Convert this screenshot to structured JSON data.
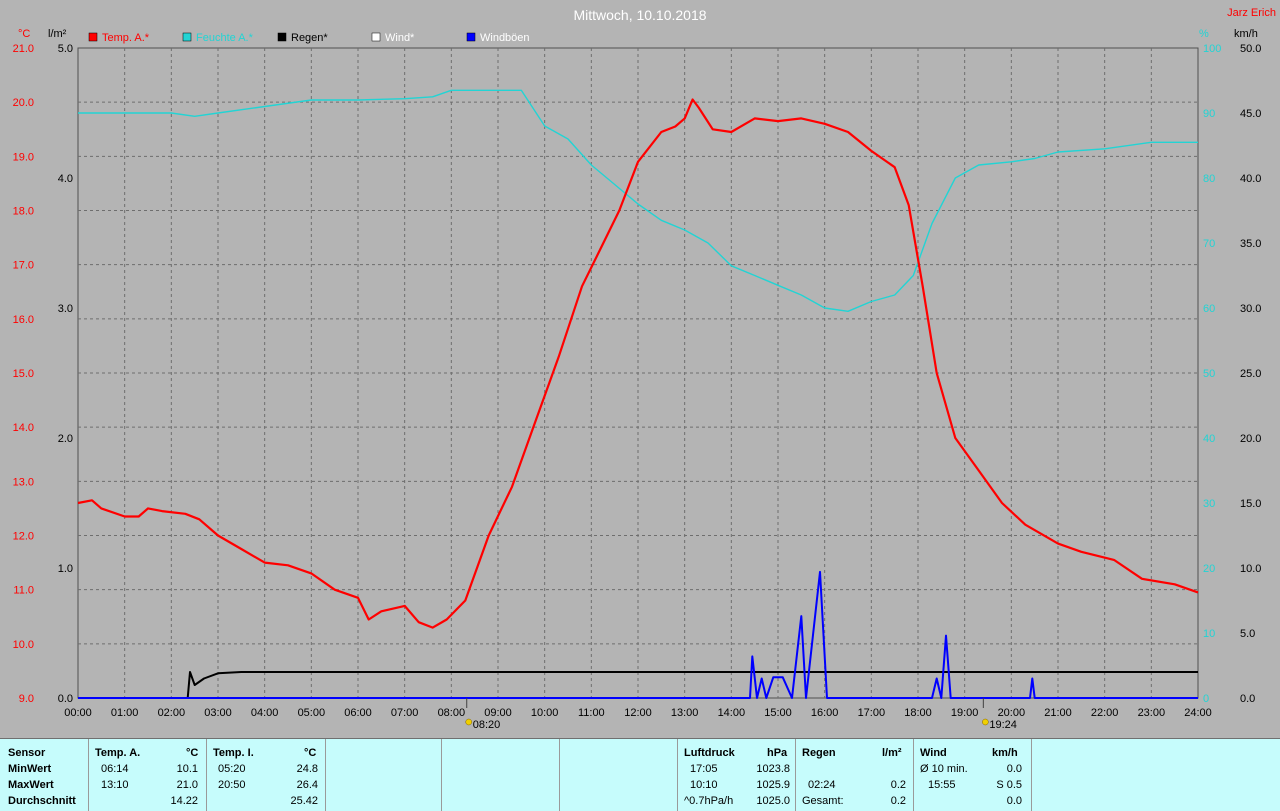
{
  "title": "Mittwoch, 10.10.2018",
  "author": "Jarz Erich",
  "colors": {
    "background": "#b4b4b4",
    "temperature": "#ff0000",
    "humidity": "#22d4d4",
    "rain": "#000000",
    "wind": "#ffffff",
    "gusts": "#0000ff",
    "panel": "#c6fcfc"
  },
  "chart_data": {
    "type": "line",
    "title": "Mittwoch, 10.10.2018",
    "x_label_format": "hh:mm",
    "xlim": [
      0,
      24
    ],
    "x_ticks": [
      "00:00",
      "01:00",
      "02:00",
      "03:00",
      "04:00",
      "05:00",
      "06:00",
      "07:00",
      "08:00",
      "09:00",
      "10:00",
      "11:00",
      "12:00",
      "13:00",
      "14:00",
      "15:00",
      "16:00",
      "17:00",
      "18:00",
      "19:00",
      "20:00",
      "21:00",
      "22:00",
      "23:00",
      "24:00"
    ],
    "axes": {
      "temperature": {
        "unit": "°C",
        "range": [
          9.0,
          21.0
        ],
        "ticks": [
          "9.0",
          "10.0",
          "11.0",
          "12.0",
          "13.0",
          "14.0",
          "15.0",
          "16.0",
          "17.0",
          "18.0",
          "19.0",
          "20.0",
          "21.0"
        ]
      },
      "rain": {
        "unit": "l/m²",
        "range": [
          0.0,
          5.0
        ],
        "ticks": [
          "0.0",
          "1.0",
          "2.0",
          "3.0",
          "4.0",
          "5.0"
        ]
      },
      "humidity": {
        "unit": "%",
        "range": [
          0,
          100
        ],
        "ticks": [
          "0",
          "10",
          "20",
          "30",
          "40",
          "50",
          "60",
          "70",
          "80",
          "90",
          "100"
        ]
      },
      "wind": {
        "unit": "km/h",
        "range": [
          0.0,
          50.0
        ],
        "ticks": [
          "0.0",
          "5.0",
          "10.0",
          "15.0",
          "20.0",
          "25.0",
          "30.0",
          "35.0",
          "40.0",
          "45.0",
          "50.0"
        ]
      }
    },
    "legend": [
      "Temp. A.*",
      "Feuchte A.*",
      "Regen*",
      "Wind*",
      "Windböen"
    ],
    "series": [
      {
        "name": "Temp. A.*",
        "axis": "temperature",
        "points": [
          [
            0,
            12.6
          ],
          [
            0.3,
            12.65
          ],
          [
            0.5,
            12.5
          ],
          [
            1,
            12.35
          ],
          [
            1.3,
            12.35
          ],
          [
            1.5,
            12.5
          ],
          [
            1.8,
            12.45
          ],
          [
            2.3,
            12.4
          ],
          [
            2.6,
            12.3
          ],
          [
            3,
            12.0
          ],
          [
            3.5,
            11.75
          ],
          [
            4,
            11.5
          ],
          [
            4.5,
            11.45
          ],
          [
            5,
            11.3
          ],
          [
            5.5,
            11.0
          ],
          [
            6.0,
            10.85
          ],
          [
            6.23,
            10.45
          ],
          [
            6.5,
            10.6
          ],
          [
            7,
            10.7
          ],
          [
            7.3,
            10.4
          ],
          [
            7.6,
            10.3
          ],
          [
            7.9,
            10.45
          ],
          [
            8.3,
            10.8
          ],
          [
            8.8,
            12.0
          ],
          [
            9.3,
            12.9
          ],
          [
            9.8,
            14.1
          ],
          [
            10.3,
            15.3
          ],
          [
            10.8,
            16.6
          ],
          [
            11.2,
            17.3
          ],
          [
            11.6,
            18.0
          ],
          [
            12.0,
            18.9
          ],
          [
            12.5,
            19.45
          ],
          [
            12.8,
            19.55
          ],
          [
            13.0,
            19.7
          ],
          [
            13.17,
            20.05
          ],
          [
            13.3,
            19.9
          ],
          [
            13.6,
            19.5
          ],
          [
            14.0,
            19.45
          ],
          [
            14.5,
            19.7
          ],
          [
            15.0,
            19.65
          ],
          [
            15.5,
            19.7
          ],
          [
            16.0,
            19.6
          ],
          [
            16.5,
            19.45
          ],
          [
            17.0,
            19.1
          ],
          [
            17.5,
            18.8
          ],
          [
            17.8,
            18.1
          ],
          [
            18.1,
            16.6
          ],
          [
            18.4,
            15.0
          ],
          [
            18.8,
            13.8
          ],
          [
            19.3,
            13.2
          ],
          [
            19.8,
            12.6
          ],
          [
            20.3,
            12.2
          ],
          [
            21.0,
            11.85
          ],
          [
            21.5,
            11.7
          ],
          [
            22.2,
            11.55
          ],
          [
            22.8,
            11.2
          ],
          [
            23.5,
            11.1
          ],
          [
            24,
            10.95
          ]
        ]
      },
      {
        "name": "Feuchte A.*",
        "axis": "humidity",
        "points": [
          [
            0,
            90
          ],
          [
            1,
            90
          ],
          [
            2,
            90
          ],
          [
            2.5,
            89.5
          ],
          [
            3,
            90
          ],
          [
            4,
            91
          ],
          [
            5,
            92
          ],
          [
            6,
            92
          ],
          [
            7,
            92.2
          ],
          [
            7.6,
            92.5
          ],
          [
            8.0,
            93.5
          ],
          [
            8.8,
            93.5
          ],
          [
            9.5,
            93.5
          ],
          [
            10.0,
            88
          ],
          [
            10.5,
            86
          ],
          [
            11.0,
            82
          ],
          [
            11.5,
            79
          ],
          [
            12.0,
            76
          ],
          [
            12.5,
            73.5
          ],
          [
            13.0,
            72
          ],
          [
            13.5,
            70
          ],
          [
            14.0,
            66.5
          ],
          [
            14.5,
            65
          ],
          [
            15.0,
            63.5
          ],
          [
            15.5,
            62
          ],
          [
            16.0,
            60
          ],
          [
            16.5,
            59.5
          ],
          [
            17.0,
            61
          ],
          [
            17.5,
            62
          ],
          [
            17.9,
            65
          ],
          [
            18.3,
            73
          ],
          [
            18.8,
            80
          ],
          [
            19.3,
            82
          ],
          [
            20.0,
            82.5
          ],
          [
            20.5,
            83
          ],
          [
            21.0,
            84
          ],
          [
            22.0,
            84.5
          ],
          [
            23.0,
            85.5
          ],
          [
            24,
            85.5
          ]
        ]
      },
      {
        "name": "Regen*",
        "axis": "rain",
        "points": [
          [
            0,
            0
          ],
          [
            2.35,
            0
          ],
          [
            2.4,
            0.2
          ],
          [
            2.5,
            0.1
          ],
          [
            2.7,
            0.15
          ],
          [
            3.0,
            0.19
          ],
          [
            3.5,
            0.2
          ],
          [
            24,
            0.2
          ]
        ]
      },
      {
        "name": "Windböen",
        "axis": "wind",
        "points": [
          [
            0,
            0
          ],
          [
            14.4,
            0
          ],
          [
            14.45,
            3.2
          ],
          [
            14.55,
            0
          ],
          [
            14.65,
            1.5
          ],
          [
            14.75,
            0
          ],
          [
            14.9,
            1.6
          ],
          [
            15.1,
            1.6
          ],
          [
            15.3,
            0
          ],
          [
            15.5,
            6.3
          ],
          [
            15.6,
            0
          ],
          [
            15.9,
            9.7
          ],
          [
            16.05,
            0
          ],
          [
            18.3,
            0
          ],
          [
            18.4,
            1.5
          ],
          [
            18.5,
            0
          ],
          [
            18.6,
            4.8
          ],
          [
            18.7,
            0
          ],
          [
            20.4,
            0
          ],
          [
            20.45,
            1.5
          ],
          [
            20.5,
            0
          ],
          [
            24,
            0
          ]
        ]
      }
    ],
    "markers": [
      {
        "time": "08:20",
        "x": 8.33,
        "label": "08:20"
      },
      {
        "time": "19:24",
        "x": 19.4,
        "label": "19:24"
      }
    ]
  },
  "summary": {
    "columns": {
      "sensor": "Sensor",
      "temp_a": "Temp. A.",
      "temp_a_unit": "°C",
      "temp_i": "Temp. I.",
      "temp_i_unit": "°C",
      "luftdruck": "Luftdruck",
      "luftdruck_unit": "hPa",
      "regen": "Regen",
      "regen_unit": "l/m²",
      "wind": "Wind",
      "wind_unit": "km/h"
    },
    "rows": [
      {
        "label": "MinWert",
        "temp_a_time": "06:14",
        "temp_a_val": "10.1",
        "temp_i_time": "05:20",
        "temp_i_val": "24.8",
        "luft_time": "17:05",
        "luft_val": "1023.8",
        "regen_time": "",
        "regen_val": "",
        "wind_label": "Ø 10 min.",
        "wind_val": "0.0"
      },
      {
        "label": "MaxWert",
        "temp_a_time": "13:10",
        "temp_a_val": "21.0",
        "temp_i_time": "20:50",
        "temp_i_val": "26.4",
        "luft_time": "10:10",
        "luft_val": "1025.9",
        "regen_time": "02:24",
        "regen_val": "0.2",
        "wind_label": "15:55",
        "wind_val": "S 0.5"
      },
      {
        "label": "Durchschnitt",
        "temp_a_time": "",
        "temp_a_val": "14.22",
        "temp_i_time": "",
        "temp_i_val": "25.42",
        "luft_time": "^0.7hPa/h",
        "luft_val": "1025.0",
        "regen_time": "Gesamt:",
        "regen_val": "0.2",
        "wind_label": "",
        "wind_val": "0.0"
      }
    ]
  }
}
